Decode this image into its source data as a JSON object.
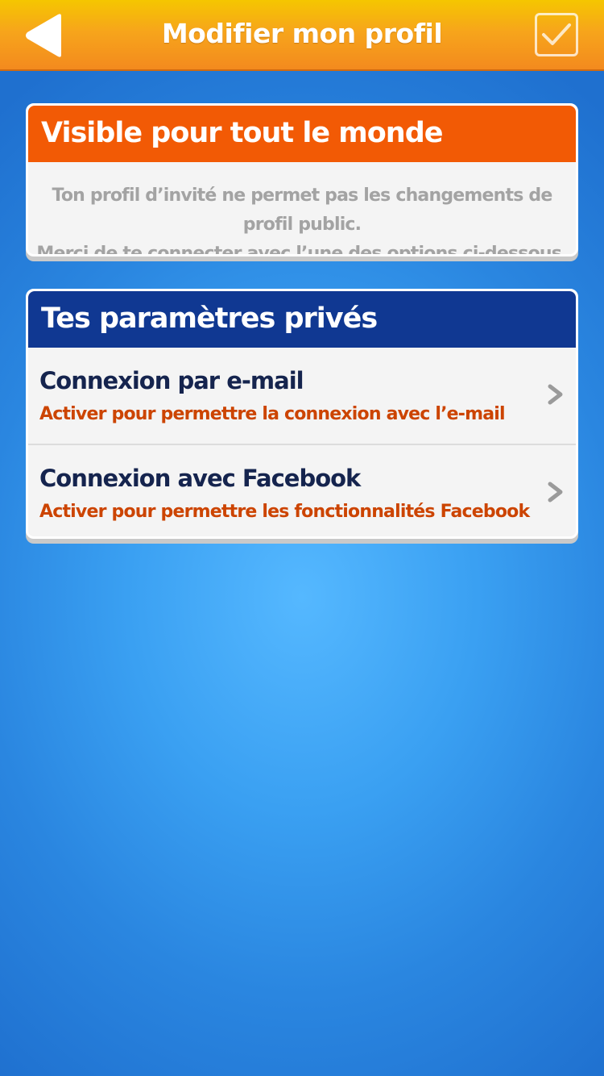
{
  "header": {
    "title": "Modifier mon profil",
    "back_icon": "back-arrow-icon",
    "confirm_icon": "checkmark-icon",
    "gradient_colors": [
      "#f5c600",
      "#f38a1e"
    ]
  },
  "public_card": {
    "heading": "Visible pour tout le monde",
    "heading_color": "#f25a05",
    "message_line1": "Ton profil d’invité ne permet pas les changements de profil public.",
    "message_line2": "Merci de te connecter avec l’une des options ci-dessous."
  },
  "private_card": {
    "heading": "Tes paramètres privés",
    "heading_color": "#103892",
    "items": [
      {
        "title": "Connexion par e-mail",
        "subtitle": "Activer pour permettre la connexion avec l’e-mail",
        "icon": "chevron-right-icon"
      },
      {
        "title": "Connexion avec Facebook",
        "subtitle": "Activer pour permettre les fonctionnalités Facebook",
        "icon": "chevron-right-icon"
      }
    ]
  },
  "colors": {
    "background": "#3aa0f2",
    "item_title": "#15244e",
    "item_subtitle": "#cc4400"
  }
}
